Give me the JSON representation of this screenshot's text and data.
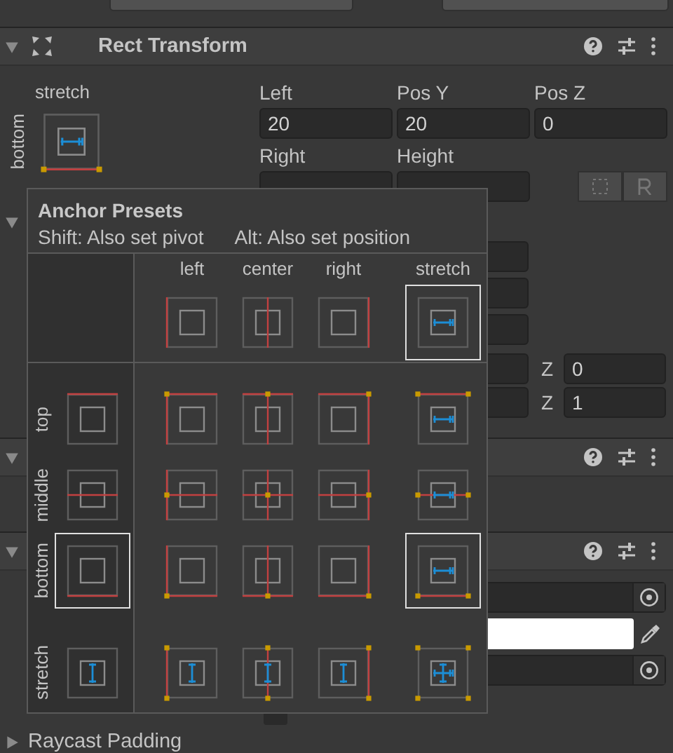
{
  "rect_transform": {
    "title": "Rect Transform",
    "expanded": true,
    "anchor_label_h": "stretch",
    "anchor_label_v": "bottom",
    "fields": [
      {
        "label": "Left",
        "value": "20"
      },
      {
        "label": "Pos Y",
        "value": "20"
      },
      {
        "label": "Pos Z",
        "value": "0"
      },
      {
        "label": "Right"
      },
      {
        "label": "Height"
      }
    ],
    "anchors_expanded": true,
    "rotation": {
      "label": "Z",
      "value": "0"
    },
    "scale": {
      "label": "Z",
      "value": "1"
    }
  },
  "components": [
    {
      "expanded": true
    },
    {
      "expanded": true
    }
  ],
  "image_fields": [
    {
      "kind": "object"
    },
    {
      "kind": "color",
      "color": "#ffffff"
    },
    {
      "kind": "object"
    }
  ],
  "raycast_padding": {
    "label": "Raycast Padding",
    "expanded": false
  },
  "anchor_presets": {
    "title": "Anchor Presets",
    "hint_shift": "Shift: Also set pivot",
    "hint_alt": "Alt: Also set position",
    "columns": [
      {
        "label": "left",
        "kind": "left",
        "selected": false
      },
      {
        "label": "center",
        "kind": "center",
        "selected": false
      },
      {
        "label": "right",
        "kind": "right",
        "selected": false
      },
      {
        "label": "stretch",
        "kind": "stretch",
        "selected": true
      }
    ],
    "rows": [
      {
        "label": "top",
        "kind": "top",
        "selected": false
      },
      {
        "label": "middle",
        "kind": "middle",
        "selected": false
      },
      {
        "label": "bottom",
        "kind": "bottom",
        "selected": true
      },
      {
        "label": "stretch",
        "kind": "stretch",
        "selected": false
      }
    ]
  }
}
